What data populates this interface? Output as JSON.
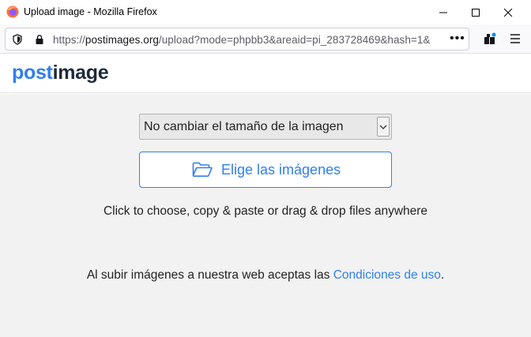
{
  "window": {
    "title": "Upload image - Mozilla Firefox"
  },
  "browser": {
    "url_prefix": "https://",
    "url_domain": "postimages.org",
    "url_path": "/upload?mode=phpbb3&areaid=pi_283728469&hash=1&",
    "more_label": "•••"
  },
  "site": {
    "logo_part1": "post",
    "logo_part2": "image"
  },
  "upload": {
    "resize_selected": "No cambiar el tamaño de la imagen",
    "choose_button_label": "Elige las imágenes",
    "hint_text": "Click to choose, copy & paste or drag & drop files anywhere",
    "terms_prefix": "Al subir imágenes a nuestra web aceptas las ",
    "terms_link": "Condiciones de uso",
    "terms_suffix": "."
  },
  "colors": {
    "accent": "#2f80ed",
    "logo_dark": "#1f2a3c",
    "content_bg": "#f2f2f2"
  },
  "icons": [
    "firefox-icon",
    "minimize-icon",
    "maximize-icon",
    "close-icon",
    "shield-icon",
    "lock-icon",
    "extensions-icon",
    "menu-icon",
    "folder-open-icon",
    "chevron-down-icon"
  ]
}
